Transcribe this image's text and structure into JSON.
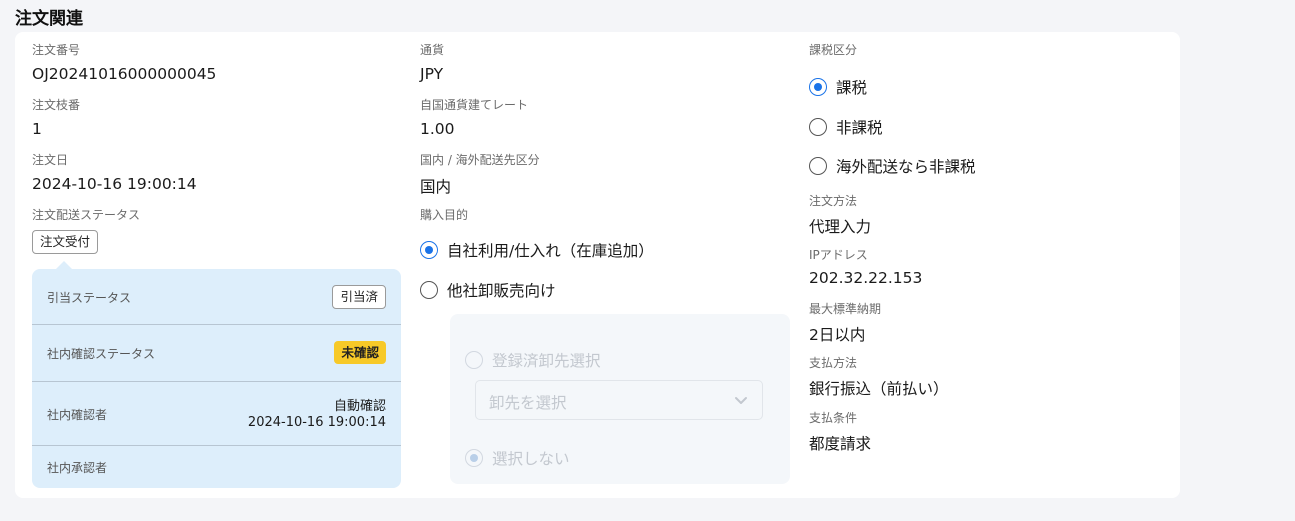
{
  "section": {
    "title": "注文関連"
  },
  "col1": {
    "order_number_label": "注文番号",
    "order_number": "OJ20241016000000045",
    "order_branch_label": "注文枝番",
    "order_branch": "1",
    "order_date_label": "注文日",
    "order_date": "2024-10-16 19:00:14",
    "shipping_status_label": "注文配送ステータス",
    "shipping_status_tag": "注文受付"
  },
  "popover": {
    "allocation_label": "引当ステータス",
    "allocation_tag": "引当済",
    "internal_check_label": "社内確認ステータス",
    "internal_check_badge": "未確認",
    "checker_label": "社内確認者",
    "checker_name": "自動確認",
    "checker_date": "2024-10-16 19:00:14",
    "approver_label": "社内承認者"
  },
  "col2": {
    "currency_label": "通貨",
    "currency": "JPY",
    "rate_label": "自国通貨建てレート",
    "rate": "1.00",
    "domestic_label": "国内 / 海外配送先区分",
    "domestic": "国内",
    "purpose_label": "購入目的",
    "purpose_options": [
      "自社利用/仕入れ（在庫追加）",
      "他社卸販売向け"
    ],
    "purpose_selected": 0,
    "wholesale": {
      "registered_option": "登録済卸先選択",
      "select_placeholder": "卸先を選択",
      "none_option": "選択しない"
    }
  },
  "col3": {
    "tax_label": "課税区分",
    "tax_options": [
      "課税",
      "非課税",
      "海外配送なら非課税"
    ],
    "tax_selected": 0,
    "order_method_label": "注文方法",
    "order_method": "代理入力",
    "ip_label": "IPアドレス",
    "ip": "202.32.22.153",
    "lead_time_label": "最大標準納期",
    "lead_time": "2日以内",
    "payment_method_label": "支払方法",
    "payment_method": "銀行振込（前払い）",
    "payment_terms_label": "支払条件",
    "payment_terms": "都度請求"
  },
  "colors": {
    "accent": "#1a73e8",
    "badge_yellow": "#f7c928",
    "popover_bg": "#ddeefb"
  }
}
